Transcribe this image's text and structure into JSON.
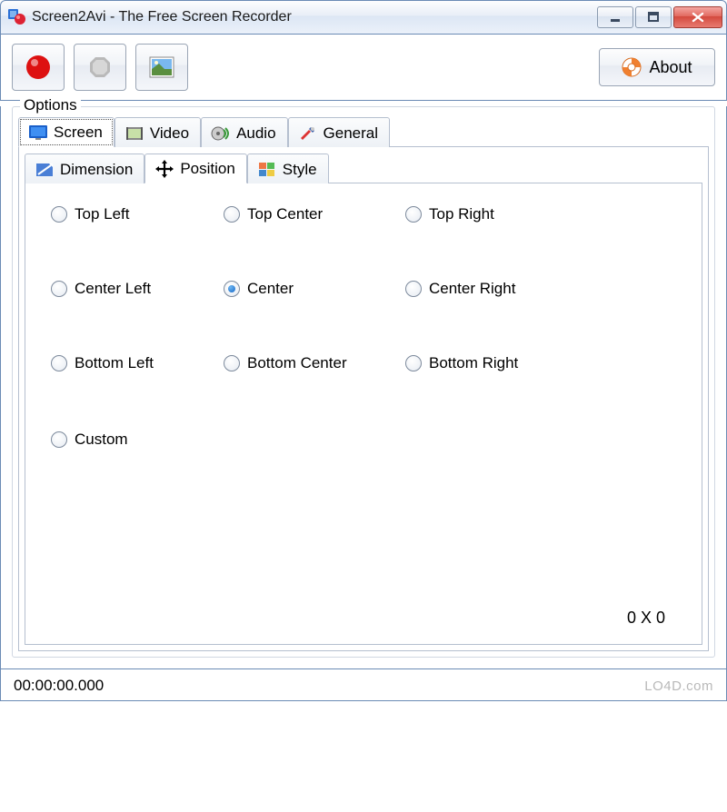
{
  "window": {
    "title": "Screen2Avi - The Free Screen Recorder"
  },
  "toolbar": {
    "about_label": "About"
  },
  "options": {
    "label": "Options",
    "tabs": {
      "screen": "Screen",
      "video": "Video",
      "audio": "Audio",
      "general": "General"
    },
    "subtabs": {
      "dimension": "Dimension",
      "position": "Position",
      "style": "Style"
    },
    "position": {
      "top_left": "Top Left",
      "top_center": "Top Center",
      "top_right": "Top Right",
      "center_left": "Center Left",
      "center": "Center",
      "center_right": "Center Right",
      "bottom_left": "Bottom Left",
      "bottom_center": "Bottom Center",
      "bottom_right": "Bottom Right",
      "custom": "Custom",
      "selected": "center",
      "dimensions": "0     X  0"
    }
  },
  "status": {
    "time": "00:00:00.000"
  },
  "watermark": "LO4D.com"
}
